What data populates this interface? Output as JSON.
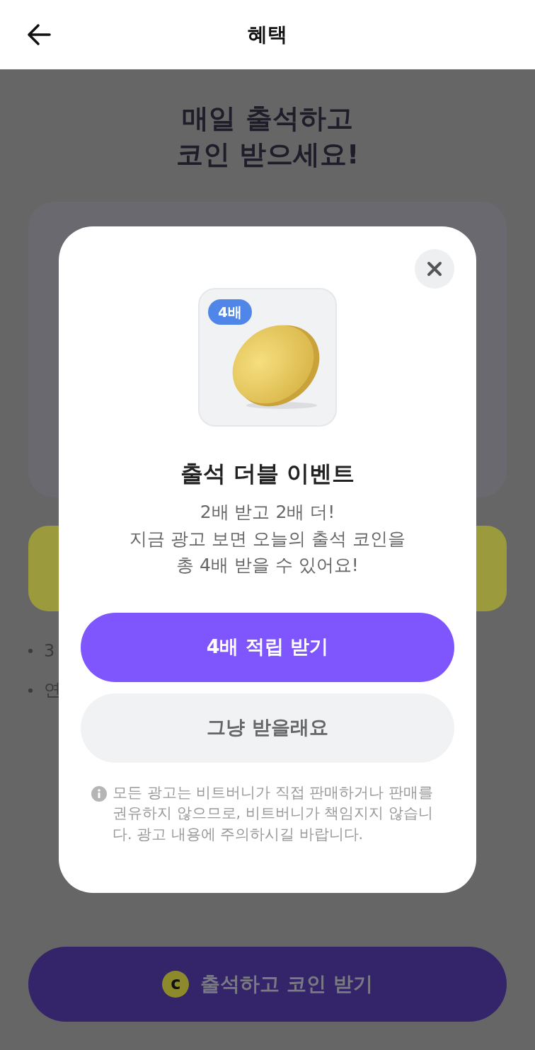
{
  "header": {
    "title": "혜택"
  },
  "background": {
    "heading": [
      "매일 출석하고",
      "코인 받으세요!"
    ],
    "notes": [
      "3",
      "연"
    ],
    "cta": {
      "icon_letter": "c",
      "label": "출석하고 코인 받기"
    }
  },
  "modal": {
    "badge": "4배",
    "title": "출석 더블 이벤트",
    "message": [
      "2배 받고 2배 더!",
      "지금 광고 보면 오늘의 출석 코인을",
      "총 4배 받을 수 있어요!"
    ],
    "buttons": [
      {
        "kind": "primary",
        "label": "4배 적립 받기"
      },
      {
        "kind": "secondary",
        "label": "그냥 받을래요"
      }
    ],
    "notice": "모든 광고는 비트버니가 직접 판매하거나 판매를 권유하지 않으므로, 비트버니가 책임지지 않습니다. 광고 내용에 주의하시길 바랍니다."
  }
}
